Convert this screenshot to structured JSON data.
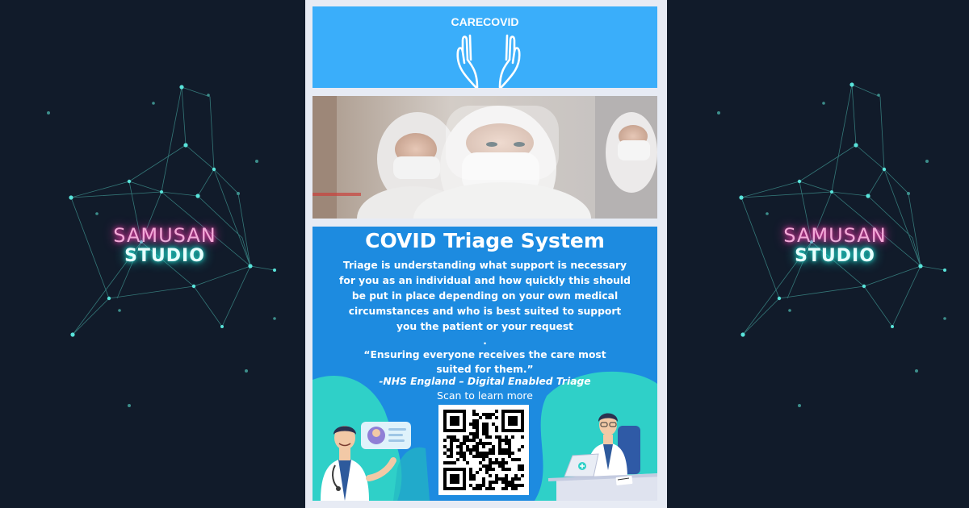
{
  "brand": {
    "line1": "SAMUSAN",
    "line2": "STUDIO"
  },
  "poster": {
    "logo_text": "CARECOVID",
    "headline": "COVID Triage System",
    "body": "Triage is understanding what support is necessary for you as an individual and how quickly this should be put in place depending on your own medical circumstances and who is best suited to support you the patient or your request",
    "separator": ".",
    "quote": "“Ensuring everyone receives the care most suited for them.”",
    "source": "-NHS England – Digital Enabled Triage",
    "cta": "Scan to learn more"
  },
  "colors": {
    "background": "#111b2a",
    "top_panel": "#3aaefa",
    "main_panel": "#1d8be0",
    "teal_blob": "#2fd0c8",
    "neon_pink": "#ff3fb4",
    "neon_cyan": "#23e7d9"
  },
  "icons": [
    "praying-hands-icon",
    "network-constellation",
    "qr-code"
  ]
}
